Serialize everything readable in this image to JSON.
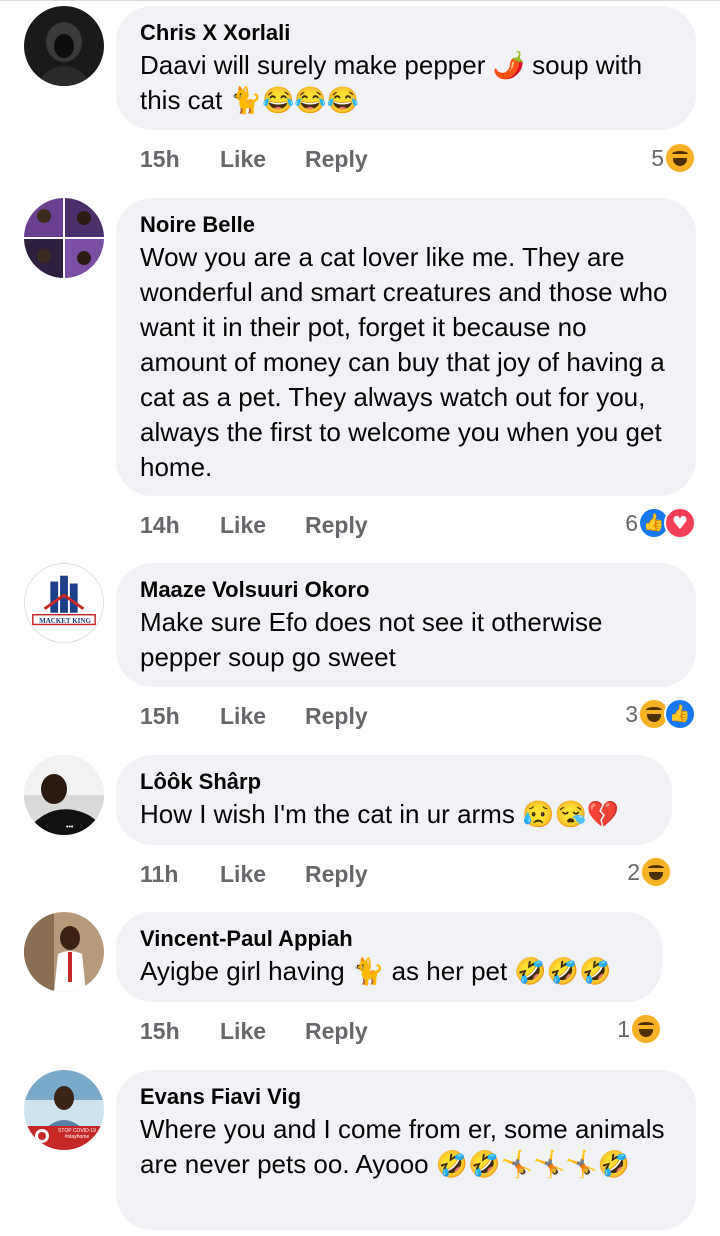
{
  "comments": [
    {
      "name": "Chris X Xorlali",
      "text": "Daavi will surely make pepper 🌶️ soup with this cat 🐈😂😂😂",
      "time": "15h",
      "like": "Like",
      "reply": "Reply",
      "reaction_count": "5",
      "reactions": [
        "haha"
      ]
    },
    {
      "name": "Noire Belle",
      "text": "Wow you are a cat lover like me. They are wonderful and smart creatures and those who want it in their pot, forget it because no amount of money can buy that joy of having a cat as a pet. They always watch out for you, always the first to welcome you when you get home.",
      "time": "14h",
      "like": "Like",
      "reply": "Reply",
      "reaction_count": "6",
      "reactions": [
        "like",
        "love"
      ]
    },
    {
      "name": "Maaze Volsuuri Okoro",
      "text": "Make sure Efo does not see it otherwise pepper soup go sweet",
      "time": "15h",
      "like": "Like",
      "reply": "Reply",
      "reaction_count": "3",
      "reactions": [
        "haha",
        "like"
      ],
      "avatar_label": "MACKET KING"
    },
    {
      "name": "Lôôk Shârp",
      "text": "How I wish I'm the cat in ur arms 😥😪💔",
      "time": "11h",
      "like": "Like",
      "reply": "Reply",
      "reaction_count": "2",
      "reactions": [
        "haha"
      ]
    },
    {
      "name": "Vincent-Paul Appiah",
      "text": "Ayigbe girl having 🐈 as her pet 🤣🤣🤣",
      "time": "15h",
      "like": "Like",
      "reply": "Reply",
      "reaction_count": "1",
      "reactions": [
        "haha"
      ]
    },
    {
      "name": "Evans Fiavi Vig",
      "text": "Where you and I come from er, some animals are never pets oo. Ayooo 🤣🤣🤸🤸🤸🤣",
      "avatar_label": "STOP COVID-19 #stayhome"
    }
  ],
  "colors": {
    "bubble": "#f0f2f5",
    "meta_text": "#65676b",
    "like_blue": "#1877f2",
    "love_red": "#f33e58",
    "haha_yellow": "#f7b125"
  }
}
